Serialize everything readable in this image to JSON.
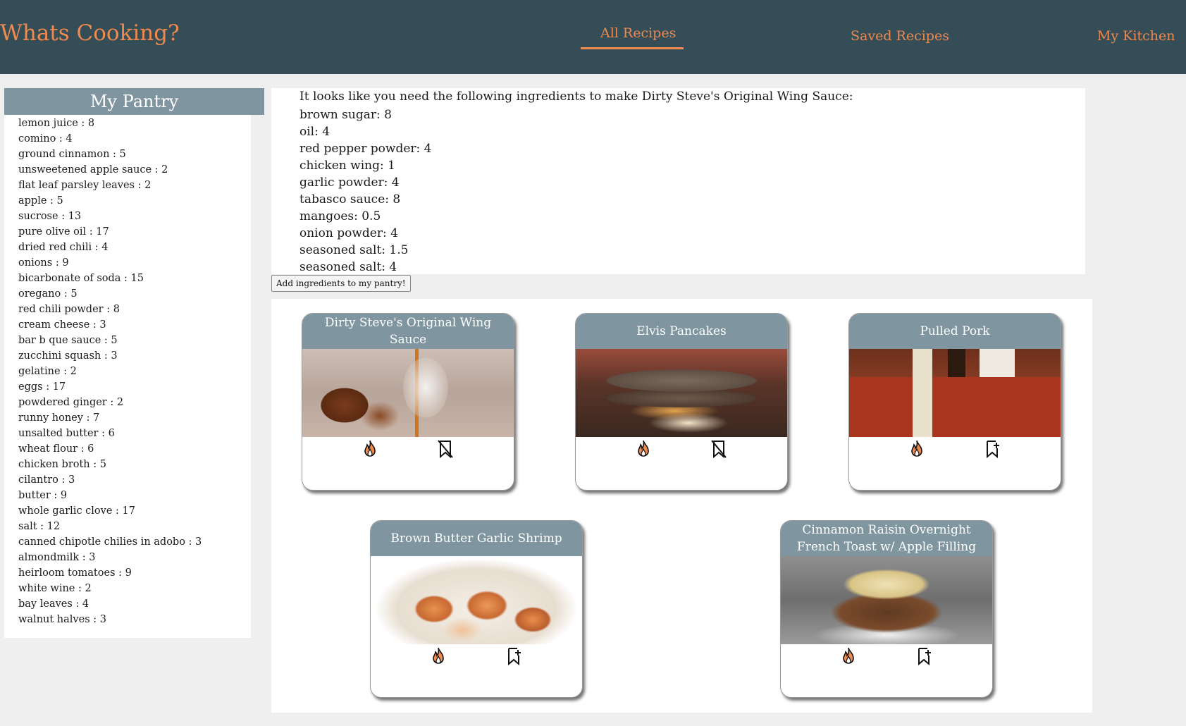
{
  "app": {
    "title": "Whats Cooking?",
    "nav": [
      {
        "label": "All Recipes",
        "active": true
      },
      {
        "label": "Saved Recipes",
        "active": false
      },
      {
        "label": "My Kitchen",
        "active": false
      }
    ]
  },
  "colors": {
    "header_bg": "#354d57",
    "accent": "#ee8a4f",
    "panel_header_bg": "#7f96a0",
    "page_bg": "#efefef"
  },
  "pantry": {
    "title": "My Pantry",
    "items": [
      "lemon juice : 8",
      "comino : 4",
      "ground cinnamon : 5",
      "unsweetened apple sauce : 2",
      "flat leaf parsley leaves : 2",
      "apple : 5",
      "sucrose : 13",
      "pure olive oil : 17",
      "dried red chili : 4",
      "onions : 9",
      "bicarbonate of soda : 15",
      "oregano : 5",
      "red chili powder : 8",
      "cream cheese : 3",
      "bar b que sauce : 5",
      "zucchini squash : 3",
      "gelatine : 2",
      "eggs : 17",
      "powdered ginger : 2",
      "runny honey : 7",
      "unsalted butter : 6",
      "wheat flour : 6",
      "chicken broth : 5",
      "cilantro : 3",
      "butter : 9",
      "whole garlic clove : 17",
      "salt : 12",
      "canned chipotle chilies in adobo : 3",
      "almondmilk : 3",
      "heirloom tomatoes : 9",
      "white wine : 2",
      "bay leaves : 4",
      "walnut halves : 3"
    ]
  },
  "needed": {
    "intro": "It looks like you need the following ingredients to make Dirty Steve's Original Wing Sauce:",
    "items": [
      "brown sugar: 8",
      "oil: 4",
      "red pepper powder: 4",
      "chicken wing: 1",
      "garlic powder: 4",
      "tabasco sauce: 8",
      "mangoes: 0.5",
      "onion powder: 4",
      "seasoned salt: 1.5",
      "seasoned salt: 4"
    ],
    "add_button_label": "Add ingredients to my pantry!"
  },
  "recipes": [
    {
      "title": "Dirty Steve's Original Wing Sauce",
      "image": "wing-sauce-photo",
      "saved": true
    },
    {
      "title": "Elvis Pancakes",
      "image": "pancake-photo",
      "saved": true
    },
    {
      "title": "Pulled Pork",
      "image": "pulled-pork-photo",
      "saved": false
    },
    {
      "title": "Brown Butter Garlic Shrimp",
      "image": "shrimp-photo",
      "saved": false
    },
    {
      "title": "Cinnamon Raisin Overnight French Toast w/ Apple Filling",
      "image": "french-toast-photo",
      "saved": false
    }
  ],
  "icons": {
    "cook": "fire-icon",
    "saved": "bookmark-remove-icon",
    "unsaved": "bookmark-add-icon"
  }
}
